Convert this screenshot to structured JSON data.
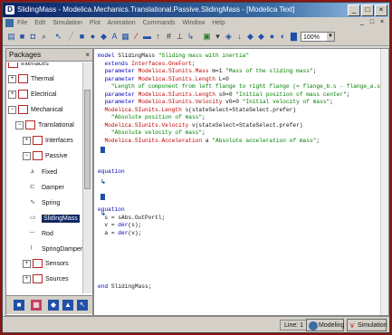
{
  "window": {
    "title": "SlidingMass - Modelica.Mechanics.Translational.Passive.SlidingMass - [Modelica Text]",
    "app_icon": "D",
    "controls": [
      "_",
      "□",
      "×"
    ],
    "doc_controls": [
      "_",
      "□",
      "×"
    ]
  },
  "menu": {
    "items": [
      "File",
      "Edit",
      "Simulation",
      "Plot",
      "Animation",
      "Commands",
      "Window",
      "Help"
    ]
  },
  "toolbar": {
    "zoom": "100%"
  },
  "packages": {
    "title": "Packages",
    "close": "×",
    "tree": [
      {
        "label": "Interfaces",
        "level": 1,
        "icon": "folder",
        "expander": ""
      },
      {
        "label": "Thermal",
        "level": 1,
        "icon": "folder",
        "expander": "+"
      },
      {
        "label": "Electrical",
        "level": 1,
        "icon": "folder",
        "expander": "+"
      },
      {
        "label": "Mechanical",
        "level": 1,
        "icon": "folder",
        "expander": "−"
      },
      {
        "label": "Translational",
        "level": 2,
        "icon": "folder",
        "expander": "−"
      },
      {
        "label": "Interfaces",
        "level": 3,
        "icon": "folder",
        "expander": "+"
      },
      {
        "label": "Passive",
        "level": 3,
        "icon": "folder",
        "expander": "−"
      },
      {
        "label": "Fixed",
        "level": 4,
        "icon": "fixed",
        "expander": ""
      },
      {
        "label": "Damper",
        "level": 4,
        "icon": "damper",
        "expander": ""
      },
      {
        "label": "Spring",
        "level": 4,
        "icon": "spring",
        "expander": ""
      },
      {
        "label": "SlidingMass",
        "level": 4,
        "icon": "mass",
        "expander": "",
        "selected": true
      },
      {
        "label": "Rod",
        "level": 4,
        "icon": "rod",
        "expander": ""
      },
      {
        "label": "SpringDamper",
        "level": 4,
        "icon": "springdamper",
        "expander": ""
      },
      {
        "label": "Sensors",
        "level": 3,
        "icon": "folder",
        "expander": "+"
      },
      {
        "label": "Sources",
        "level": 3,
        "icon": "folder",
        "expander": "+"
      }
    ]
  },
  "editor": {
    "lines": [
      [
        [
          "kw",
          "model "
        ],
        [
          "",
          "SlidingMass "
        ],
        [
          "str",
          "\"Sliding mass with inertia\""
        ]
      ],
      [
        [
          "",
          "  "
        ],
        [
          "kw",
          "extends "
        ],
        [
          "ty",
          "Interfaces.OneFort"
        ],
        [
          "",
          ";"
        ]
      ],
      [
        [
          "",
          "  "
        ],
        [
          "kw",
          "parameter "
        ],
        [
          "ty",
          "Modelica.SIunits.Mass "
        ],
        [
          "",
          "m=1 "
        ],
        [
          "str",
          "\"Mass of the sliding mass\""
        ],
        [
          "",
          ";"
        ]
      ],
      [
        [
          "",
          "  "
        ],
        [
          "kw",
          "parameter "
        ],
        [
          "ty",
          "Modelica.SIunits.Length "
        ],
        [
          "",
          "L=0"
        ]
      ],
      [
        [
          "",
          "    "
        ],
        [
          "str",
          "\"Length of component from left flange to right flange (= flange_b.s - flange_a.s)\""
        ],
        [
          "",
          ";"
        ]
      ],
      [
        [
          "",
          "  "
        ],
        [
          "kw",
          "parameter "
        ],
        [
          "ty",
          "Modelica.SIunits.Length "
        ],
        [
          "",
          "s0=0 "
        ],
        [
          "str",
          "\"Initial position of mass center\""
        ],
        [
          "",
          ";"
        ]
      ],
      [
        [
          "",
          "  "
        ],
        [
          "kw",
          "parameter "
        ],
        [
          "ty",
          "Modelica.SIunits.Velocity "
        ],
        [
          "",
          "v0=0 "
        ],
        [
          "str",
          "\"Initial velocity of mass\""
        ],
        [
          "",
          ";"
        ]
      ],
      [
        [
          "",
          "  "
        ],
        [
          "ty",
          "Modelica.SIunits.Length "
        ],
        [
          "",
          "s(stateSelect=StateSelect.prefer)"
        ]
      ],
      [
        [
          "",
          "    "
        ],
        [
          "str",
          "\"Absolute position of mass\""
        ],
        [
          "",
          ";"
        ]
      ],
      [
        [
          "",
          "  "
        ],
        [
          "ty",
          "Modelica.SIunits.Velocity "
        ],
        [
          "",
          "v(stateSelect=StateSelect.prefer)"
        ]
      ],
      [
        [
          "",
          "    "
        ],
        [
          "str",
          "\"Absolute velocity of mass\""
        ],
        [
          "",
          ";"
        ]
      ],
      [
        [
          "",
          "  "
        ],
        [
          "ty",
          "Modelica.SIunits.Acceleration "
        ],
        [
          "",
          "a "
        ],
        [
          "str",
          "\"Absolute acceleration of mass\""
        ],
        [
          "",
          ";"
        ]
      ],
      [
        [
          "",
          ""
        ]
      ],
      [
        [
          "",
          ""
        ]
      ],
      [
        [
          "",
          ""
        ]
      ],
      [
        [
          "kw",
          "equation"
        ]
      ],
      [
        [
          "",
          ""
        ]
      ],
      [
        [
          "",
          ""
        ]
      ],
      [
        [
          "",
          ""
        ]
      ],
      [
        [
          "",
          ""
        ]
      ],
      [
        [
          "kw",
          "equation"
        ]
      ],
      [
        [
          "",
          "  s = sAbs.OutPortl;"
        ]
      ],
      [
        [
          "",
          "  v = "
        ],
        [
          "kw",
          "der"
        ],
        [
          "",
          "(s);"
        ]
      ],
      [
        [
          "",
          "  a = "
        ],
        [
          "kw",
          "der"
        ],
        [
          "",
          "(v);"
        ]
      ],
      [
        [
          "",
          ""
        ]
      ],
      [
        [
          "",
          ""
        ]
      ],
      [
        [
          "",
          ""
        ]
      ],
      [
        [
          "",
          ""
        ]
      ],
      [
        [
          "",
          ""
        ]
      ],
      [
        [
          "",
          ""
        ]
      ],
      [
        [
          "kw",
          "end "
        ],
        [
          "",
          "SlidingMass;"
        ]
      ]
    ]
  },
  "statusbar": {
    "line_label": "Line:",
    "line_value": "1",
    "modeling": "Modeling",
    "simulation": "Simulation"
  }
}
